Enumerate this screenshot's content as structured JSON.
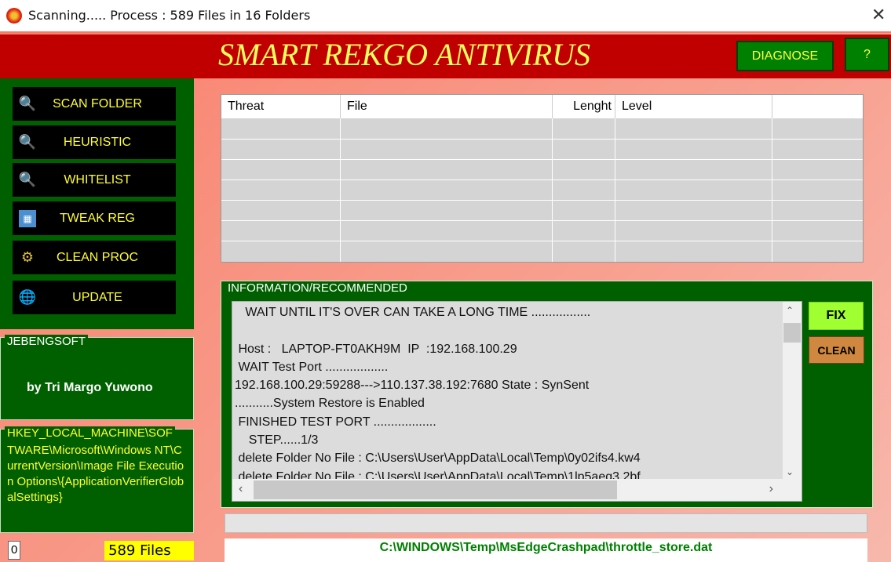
{
  "window": {
    "title": "Scanning.....  Process : 589 Files in 16 Folders",
    "close": "✕"
  },
  "header": {
    "title": "SMART REKGO ANTIVIRUS",
    "diagnose": "DIAGNOSE",
    "help": "?"
  },
  "sidebar": {
    "items": [
      {
        "label": "SCAN FOLDER",
        "icon": "magnifier-green-icon"
      },
      {
        "label": "HEURISTIC",
        "icon": "magnifier-yellow-icon"
      },
      {
        "label": "WHITELIST",
        "icon": "magnifier-red-icon"
      },
      {
        "label": "TWEAK REG",
        "icon": "registry-icon"
      },
      {
        "label": "CLEAN PROC",
        "icon": "gears-icon"
      },
      {
        "label": "UPDATE",
        "icon": "globe-icon"
      }
    ]
  },
  "about": {
    "legend": "JEBENGSOFT",
    "author": "by Tri Margo Yuwono"
  },
  "registry": {
    "legend": "HKEY_LOCAL_MACHINE\\SOF",
    "text": "TWARE\\Microsoft\\Windows NT\\CurrentVersion\\Image File Execution Options\\{ApplicationVerifierGlobalSettings}"
  },
  "counter": "0",
  "files_count": "589 Files",
  "table": {
    "columns": [
      "Threat",
      "File",
      "Lenght",
      "Level",
      ""
    ],
    "rows": []
  },
  "info": {
    "legend": "INFORMATION/RECOMMENDED",
    "lines": [
      "   WAIT UNTIL IT'S OVER CAN TAKE A LONG TIME .................",
      "",
      " Host :   LAPTOP-FT0AKH9M  IP  :192.168.100.29",
      " WAIT Test Port ..................",
      "192.168.100.29:59288--->110.137.38.192:7680 State : SynSent",
      "...........System Restore is Enabled",
      " FINISHED TEST PORT ..................",
      "    STEP......1/3",
      " delete Folder No File : C:\\Users\\User\\AppData\\Local\\Temp\\0y02ifs4.kw4",
      " delete Folder No File : C:\\Users\\User\\AppData\\Local\\Temp\\1lp5aeq3.2bf"
    ],
    "fix": "FIX",
    "clean": "CLEAN"
  },
  "progress": 0,
  "current_file": "C:\\WINDOWS\\Temp\\MsEdgeCrashpad\\throttle_store.dat",
  "colors": {
    "header": "#c00000",
    "panel": "#006000",
    "title_text": "#ffff60",
    "fix": "#a0ff30",
    "clean": "#d08840",
    "files_badge": "#ffff00"
  }
}
